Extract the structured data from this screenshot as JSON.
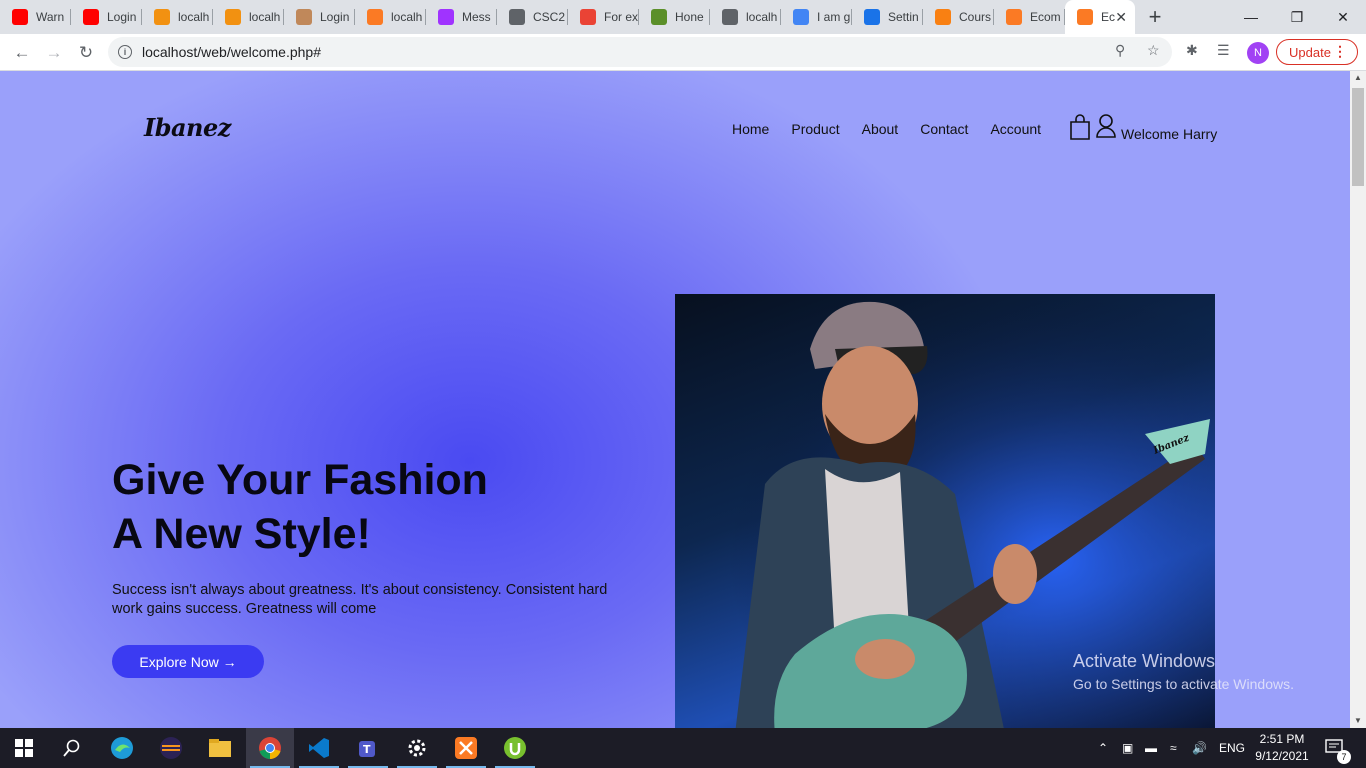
{
  "browser": {
    "tabs": [
      {
        "label": "Warn",
        "icon": "youtube-icon",
        "color": "#ff0000"
      },
      {
        "label": "Login",
        "icon": "youtube-icon",
        "color": "#ff0000"
      },
      {
        "label": "localh",
        "icon": "phpmyadmin-icon",
        "color": "#f29111"
      },
      {
        "label": "localh",
        "icon": "phpmyadmin-icon",
        "color": "#f29111"
      },
      {
        "label": "Login",
        "icon": "avatar-icon",
        "color": "#c0885a"
      },
      {
        "label": "localh",
        "icon": "xampp-icon",
        "color": "#fb7a24"
      },
      {
        "label": "Mess",
        "icon": "messenger-icon",
        "color": "#a033ff"
      },
      {
        "label": "CSC2",
        "icon": "globe-icon",
        "color": "#5f6368"
      },
      {
        "label": "For ex",
        "icon": "gmail-icon",
        "color": "#ea4335"
      },
      {
        "label": "Hone",
        "icon": "bicycle-icon",
        "color": "#5b8f29"
      },
      {
        "label": "localh",
        "icon": "globe-icon",
        "color": "#5f6368"
      },
      {
        "label": "I am g",
        "icon": "google-icon",
        "color": "#4285f4"
      },
      {
        "label": "Settin",
        "icon": "gear-icon",
        "color": "#1a73e8"
      },
      {
        "label": "Cours",
        "icon": "moodle-icon",
        "color": "#f98012"
      },
      {
        "label": "Ecom",
        "icon": "xampp-icon",
        "color": "#fb7a24"
      },
      {
        "label": "Ec",
        "icon": "xampp-icon",
        "color": "#fb7a24",
        "active": true
      }
    ],
    "url": "localhost/web/welcome.php#",
    "profile_initial": "N",
    "update_label": "Update"
  },
  "site": {
    "logo": "Ibanez",
    "nav": [
      "Home",
      "Product",
      "About",
      "Contact",
      "Account"
    ],
    "welcome": "Welcome Harry",
    "hero": {
      "title_line1": "Give Your Fashion",
      "title_line2": "A New Style!",
      "subtitle": "Success isn't always about greatness. It's about consistency. Consistent hard work gains success. Greatness will come",
      "button": "Explore Now →"
    },
    "image_text": "Ibanez"
  },
  "watermark": {
    "line1": "Activate Windows",
    "line2": "Go to Settings to activate Windows."
  },
  "taskbar": {
    "lang": "ENG",
    "time": "2:51 PM",
    "date": "9/12/2021",
    "notifications": "7"
  },
  "colors": {
    "accent": "#3b3bf2",
    "gradient_center": "#4a4af2",
    "gradient_edge": "#9aa0fa"
  }
}
